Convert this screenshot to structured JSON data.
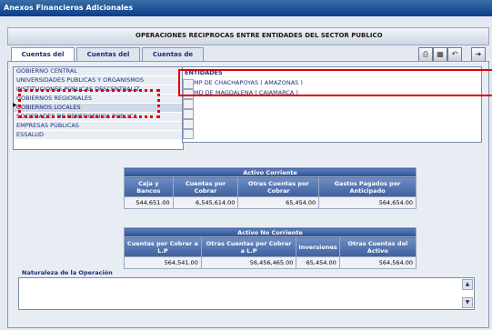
{
  "window": {
    "title": "Anexos Financieros Adicionales"
  },
  "header": {
    "title": "OPERACIONES RECIPROCAS ENTRE ENTIDADES DEL SECTOR PUBLICO"
  },
  "tabs": [
    {
      "label": "Cuentas del Activo"
    },
    {
      "label": "Cuentas del Pasivo"
    },
    {
      "label": "Cuentas de Gestión"
    }
  ],
  "toolbar": {
    "print_icon": "print-icon",
    "save_icon": "save-icon",
    "undo_icon": "undo-icon",
    "exit_icon": "exit-icon"
  },
  "sectors": [
    "GOBIERNO CENTRAL",
    "UNIVERSIDADES PUBLICAS Y ORGANISMOS",
    "INSTITUCIONES PÚBLICAS DESCENTRALIZ",
    "GOBIERNOS REGIONALES",
    "GOBIERNOS LOCALES",
    "SOCIEDADES DE BENEFICENCIA PÚBLICA",
    "EMPRESAS PÚBLICAS",
    "ESSALUD"
  ],
  "entidades": {
    "label": "ENTIDADES",
    "items": [
      "MP DE CHACHAPOYAS ( AMAZONAS )",
      "MD DE MAGDALENA ( CAJAMARCA )"
    ]
  },
  "activo_corriente": {
    "caption": "Activo Corriente",
    "headers": [
      "Caja y Bancos",
      "Cuentas por Cobrar",
      "Otras Cuentas por Cobrar",
      "Gastos Pagados por Anticipado"
    ],
    "values": [
      "544,651.00",
      "6,545,614.00",
      "65,454.00",
      "564,654.00"
    ]
  },
  "activo_no_corriente": {
    "caption": "Activo No Corriente",
    "headers": [
      "Cuentas por Cobrar a L.P",
      "Otras Cuentas por Cobrar a L.P",
      "Inversiones",
      "Otras Cuentas del Activo"
    ],
    "values": [
      "564,541.00",
      "56,456,465.00",
      "65,454.00",
      "564,564.00"
    ]
  },
  "naturaleza": {
    "label": "Naturaleza de la Operación",
    "value": ""
  },
  "colors": {
    "accent": "#e00000",
    "table_header": "#3f5f9f"
  }
}
